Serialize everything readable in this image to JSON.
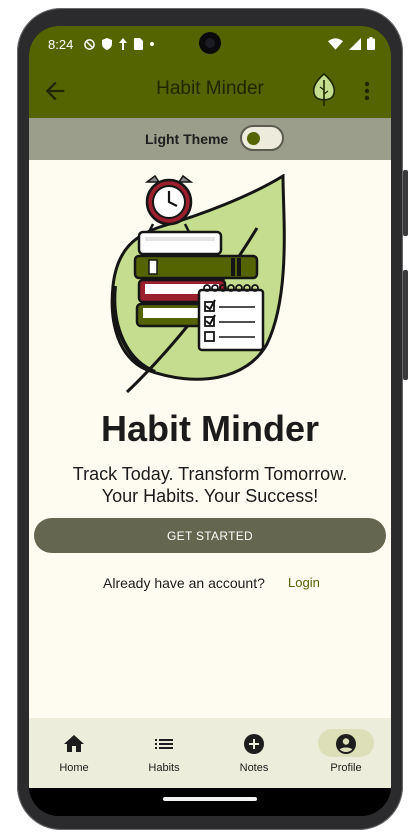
{
  "status_bar": {
    "time": "8:24"
  },
  "app_bar": {
    "title": "Habit Minder"
  },
  "theme_bar": {
    "label": "Light Theme",
    "toggle_on": false
  },
  "main": {
    "brand": "Habit Minder",
    "tagline_line1": "Track Today. Transform Tomorrow.",
    "tagline_line2": "Your Habits. Your Success!",
    "cta_label": "GET STARTED",
    "account_prompt": "Already have an account?",
    "login_label": "Login"
  },
  "bottom_nav": {
    "items": [
      {
        "label": "Home",
        "icon": "home-icon",
        "selected": false
      },
      {
        "label": "Habits",
        "icon": "list-icon",
        "selected": false
      },
      {
        "label": "Notes",
        "icon": "add-circle-icon",
        "selected": false
      },
      {
        "label": "Profile",
        "icon": "account-circle-icon",
        "selected": true
      }
    ]
  },
  "colors": {
    "primary": "#546400",
    "on_primary_text": "#1f2600",
    "theme_bar": "#9a9e8a",
    "background": "#fefbf1",
    "button": "#65664f",
    "nav_bg": "#ecedda",
    "nav_selected": "#dcdfb8"
  }
}
